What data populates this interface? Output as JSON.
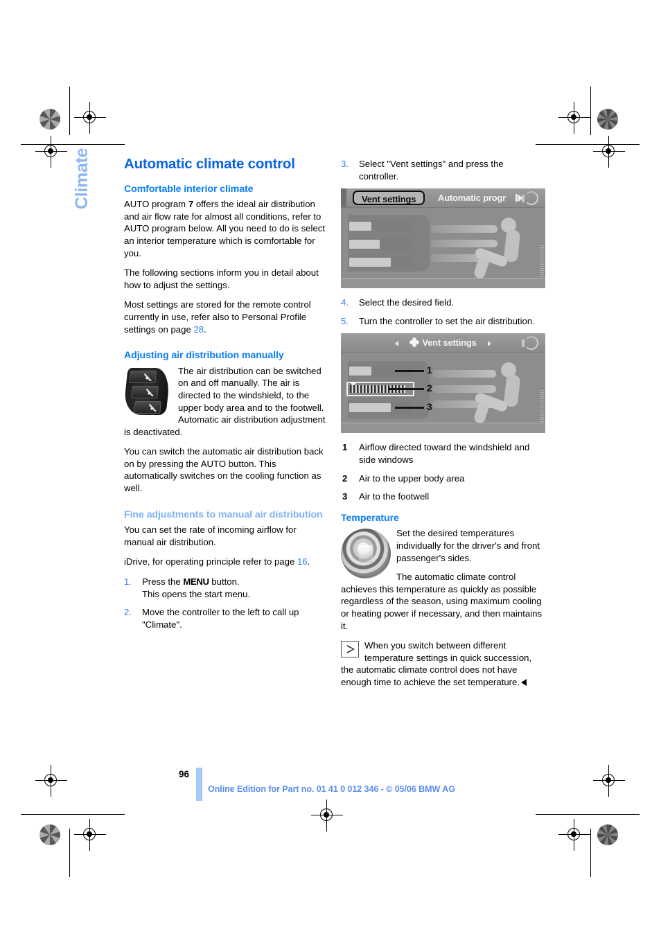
{
  "chapter_tab": "Climate",
  "title": "Automatic climate control",
  "left_column": {
    "section1": {
      "heading": "Comfortable interior climate",
      "p1_a": "AUTO program ",
      "p1_bold": "7",
      "p1_b": " offers the ideal air distribution and air flow rate for almost all conditions, refer to AUTO program below. All you need to do is select an interior temperature which is comfortable for you.",
      "p2": "The following sections inform you in detail about how to adjust the settings.",
      "p3_a": "Most settings are stored for the remote control currently in use, refer also to Personal Profile settings on page ",
      "p3_ref": "28",
      "p3_b": "."
    },
    "section2": {
      "heading": "Adjusting air distribution manually",
      "p1": "The air distribution can be switched on and off manually. The air is directed to the windshield, to the upper body area and to the footwell. Automatic air distribution adjustment is deactivated.",
      "p2": "You can switch the automatic air distribution back on by pressing the AUTO button. This automatically switches on the cooling function as well.",
      "button_icon": "air-distribution-buttons-photo"
    },
    "section3": {
      "heading": "Fine adjustments to manual air distribution",
      "p1": "You can set the rate of incoming airflow for manual air distribution.",
      "p2_a": "iDrive, for operating principle refer to page ",
      "p2_ref": "16",
      "p2_b": ".",
      "steps": [
        {
          "num": "1.",
          "text_a": "Press the ",
          "bold": "MENU",
          "text_b": " button.",
          "line2": "This opens the start menu."
        },
        {
          "num": "2.",
          "text_a": "Move the controller to the left to call up \"Climate\".",
          "bold": "",
          "text_b": "",
          "line2": ""
        }
      ]
    }
  },
  "right_column": {
    "step3": {
      "num": "3.",
      "text": "Select \"Vent settings\" and press the controller."
    },
    "screen1": {
      "tab_selected": "Vent settings",
      "tab_next": "Automatic progr",
      "corner_icon": "climate-menu-icon"
    },
    "step4": {
      "num": "4.",
      "text": "Select the desired field."
    },
    "step5": {
      "num": "5.",
      "text": "Turn the controller to set the air distribution."
    },
    "screen2": {
      "title": "Vent settings",
      "fan_icon": "fan-icon",
      "arrow_left": "left-arrow-icon",
      "arrow_right": "right-arrow-icon",
      "corner_icon": "climate-menu-icon",
      "callouts": [
        "1",
        "2",
        "3"
      ]
    },
    "legend": [
      {
        "num": "1",
        "text": "Airflow directed toward the windshield and side windows"
      },
      {
        "num": "2",
        "text": "Air to the upper body area"
      },
      {
        "num": "3",
        "text": "Air to the footwell"
      }
    ],
    "temperature": {
      "heading": "Temperature",
      "knob_icon": "temperature-rotary-knob-photo",
      "p1": "Set the desired temperatures individually for the driver's and front passenger's sides.",
      "p2": "The automatic climate control achieves this temperature as quickly as possible regardless of the season, using maximum cooling or heating power if necessary, and then maintains it.",
      "note_icon": "note-triangle-icon",
      "note": "When you switch between different temperature settings in quick succession, the automatic climate control does not have enough time to achieve the set temperature."
    }
  },
  "footer": {
    "page_number": "96",
    "text": "Online Edition for Part no. 01 41 0 012 346 - © 05/06 BMW AG"
  }
}
